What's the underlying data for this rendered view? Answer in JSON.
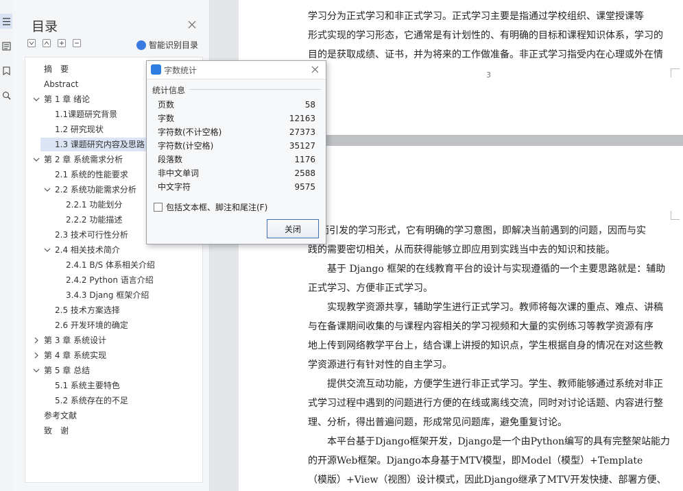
{
  "nav": {
    "title": "目录",
    "smart_toc_label": "智能识别目录",
    "items": [
      {
        "label": "摘　要",
        "level": 1,
        "expand": "none"
      },
      {
        "label": "Abstract",
        "level": 1,
        "expand": "none"
      },
      {
        "label": "第 1 章  绪论",
        "level": 1,
        "expand": "open"
      },
      {
        "label": "1.1课题研究背景",
        "level": 2,
        "expand": "none"
      },
      {
        "label": "1.2 研究现状",
        "level": 2,
        "expand": "none"
      },
      {
        "label": "1.3 课题研究内容及思路",
        "level": 2,
        "expand": "none",
        "selected": true
      },
      {
        "label": "第 2 章  系统需求分析",
        "level": 1,
        "expand": "open"
      },
      {
        "label": "2.1 系统的性能要求",
        "level": 2,
        "expand": "none"
      },
      {
        "label": "2.2 系统功能需求分析",
        "level": 2,
        "expand": "open"
      },
      {
        "label": "2.2.1 功能划分",
        "level": 3,
        "expand": "none"
      },
      {
        "label": "2.2.2 功能描述",
        "level": 3,
        "expand": "none"
      },
      {
        "label": "2.3 技术可行性分析",
        "level": 2,
        "expand": "none"
      },
      {
        "label": "2.4 相关技术简介",
        "level": 2,
        "expand": "open"
      },
      {
        "label": "2.4.1 B/S 体系相关介绍",
        "level": 3,
        "expand": "none"
      },
      {
        "label": "2.4.2 Python 语言介绍",
        "level": 3,
        "expand": "none"
      },
      {
        "label": "3.4.3 Djang 框架介绍",
        "level": 3,
        "expand": "none"
      },
      {
        "label": "2.5 技术方案选择",
        "level": 2,
        "expand": "none"
      },
      {
        "label": "2.6 开发环境的确定",
        "level": 2,
        "expand": "none"
      },
      {
        "label": "第 3 章  系统设计",
        "level": 1,
        "expand": "closed"
      },
      {
        "label": "第 4 章  系统实现",
        "level": 1,
        "expand": "closed"
      },
      {
        "label": "第 5 章  总结",
        "level": 1,
        "expand": "open"
      },
      {
        "label": "5.1 系统主要特色",
        "level": 2,
        "expand": "none"
      },
      {
        "label": "5.2 系统存在的不足",
        "level": 2,
        "expand": "none"
      },
      {
        "label": "参考文献",
        "level": 1,
        "expand": "none"
      },
      {
        "label": "致　谢",
        "level": 1,
        "expand": "none"
      }
    ]
  },
  "document": {
    "page_number": "3",
    "page1_lines": [
      "学习分为正式学习和非正式学习。正式学习主要是指通过学校组织、课堂授课等",
      "形式实现的学习形态，它通常是有计划性的、有明确的目标和课程知识体系，学习的",
      "目的是获取成绩、证书，并为将来的工作做准备。非正式学习指受内在心理或外在情"
    ],
    "page2_lines": [
      "驱动而引发的学习形式，它有明确的学习意图，即解决当前遇到的问题，因而与实",
      "践的需要密切相关，从而获得能够立即应用到实践当中去的知识和技能。",
      "　　基于 Django 框架的在线教育平台的设计与实现遵循的一个主要思路就是：辅助",
      "正式学习、方便非正式学习。",
      "　　实现教学资源共享，辅助学生进行正式学习。教师将每次课的重点、难点、讲稿",
      "与在备课期间收集的与课程内容相关的学习视频和大量的实例练习等教学资源有序",
      "地上传到网络教学平台上，结合课上讲授的知识点，学生根据自身的情况在对这些教",
      "学资源进行有针对性的自主学习。",
      "　　提供交流互动功能，方便学生进行非正式学习。学生、教师能够通过系统对非正",
      "式学习过程中遇到的问题进行方便的在线或离线交流，同时对讨论话题、内容进行整",
      "理、分析，得出普遍问题，形成常见问题库，避免重复讨论。",
      "　　本平台基于Django框架开发，Django是一个由Python编写的具有完整架站能力",
      "的开源Web框架。Django本身基于MTV模型，即Model（模型）+Template",
      "（模版）+View（视图）设计模式，因此Django继承了MTV开发快捷、部署方便、"
    ]
  },
  "dialog": {
    "title": "字数统计",
    "group_label": "统计信息",
    "stats": [
      {
        "label": "页数",
        "value": "58"
      },
      {
        "label": "字数",
        "value": "12163"
      },
      {
        "label": "字符数(不计空格)",
        "value": "27373"
      },
      {
        "label": "字符数(计空格)",
        "value": "35127"
      },
      {
        "label": "段落数",
        "value": "1176"
      },
      {
        "label": "非中文单词",
        "value": "2588"
      },
      {
        "label": "中文字符",
        "value": "9575"
      }
    ],
    "checkbox_label": "包括文本框、脚注和尾注(F)",
    "checkbox_checked": false,
    "close_button": "关闭"
  },
  "colors": {
    "accent": "#2f7de1",
    "selection": "#dbe5f6"
  }
}
